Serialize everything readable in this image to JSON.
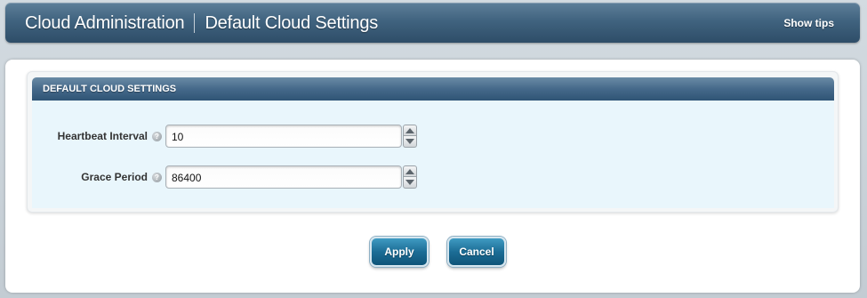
{
  "header": {
    "app_title": "Cloud Administration",
    "page_title": "Default Cloud Settings",
    "show_tips_label": "Show tips"
  },
  "section": {
    "title": "DEFAULT CLOUD SETTINGS",
    "fields": [
      {
        "label": "Heartbeat Interval",
        "help_icon": "question-icon",
        "value": "10"
      },
      {
        "label": "Grace Period",
        "help_icon": "question-icon",
        "value": "86400"
      }
    ]
  },
  "buttons": {
    "apply_label": "Apply",
    "cancel_label": "Cancel"
  },
  "colors": {
    "header_bar": "#40637f",
    "section_header": "#45698a",
    "section_body": "#e9f6fc",
    "button": "#1c6d96"
  }
}
